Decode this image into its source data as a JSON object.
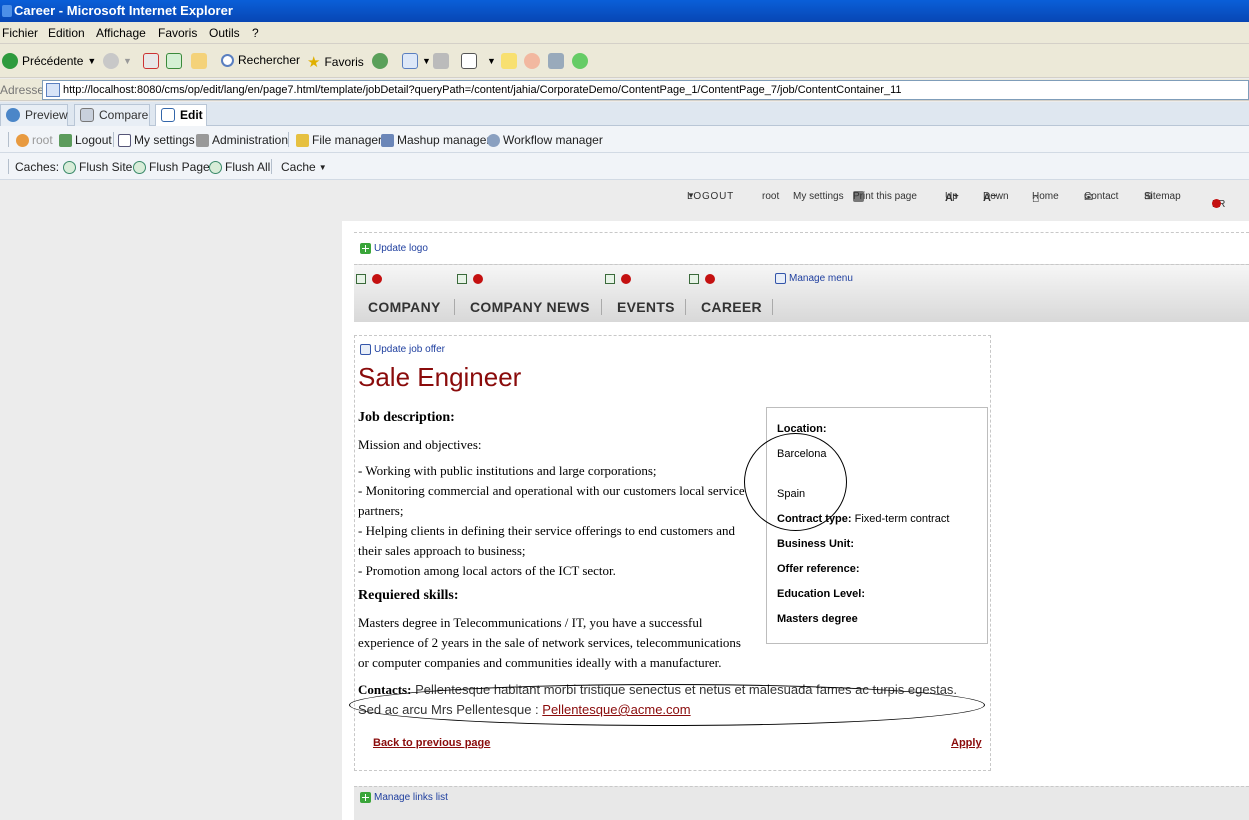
{
  "window": {
    "title": "Career - Microsoft Internet Explorer"
  },
  "menu": [
    "Fichier",
    "Edition",
    "Affichage",
    "Favoris",
    "Outils",
    "?"
  ],
  "toolbar": {
    "back": "Précédente",
    "search": "Rechercher",
    "favorites": "Favoris"
  },
  "address": {
    "label": "Adresse",
    "url": "http://localhost:8080/cms/op/edit/lang/en/page7.html/template/jobDetail?queryPath=/content/jahia/CorporateDemo/ContentPage_1/ContentPage_7/job/ContentContainer_11"
  },
  "tabs": [
    "Preview",
    "Compare",
    "Edit"
  ],
  "actions": {
    "user": "root",
    "logout": "Logout",
    "settings": "My settings",
    "admin": "Administration",
    "file_manager": "File manager",
    "mashup_manager": "Mashup manager",
    "workflow_manager": "Workflow manager"
  },
  "cache": {
    "label": "Caches:",
    "flush_site": "Flush Site",
    "flush_page": "Flush Page",
    "flush_all": "Flush All",
    "cache_menu": "Cache"
  },
  "utility": {
    "logout": "LOGOUT",
    "user": "root",
    "settings": "My settings",
    "print": "Print this page",
    "up": "Up",
    "down": "Down",
    "home": "Home",
    "contact": "Contact",
    "sitemap": "Sitemap",
    "lang": "FR"
  },
  "page": {
    "update_logo": "Update logo",
    "manage_menu": "Manage menu",
    "nav": [
      "COMPANY",
      "COMPANY NEWS",
      "EVENTS",
      "CAREER"
    ],
    "update_job": "Update job offer",
    "job_title": "Sale Engineer",
    "desc_heading": "Job description:",
    "desc_lines": [
      "Mission and objectives:",
      "- Working with public institutions and large corporations;",
      "- Monitoring commercial and operational with our customers local service",
      "partners;",
      "- Helping clients in defining their service offerings to end customers and",
      "their sales approach to business;",
      "- Promotion among local actors of the ICT sector."
    ],
    "skills_heading": "Requiered skills:",
    "skills_lines": [
      "Masters degree in Telecommunications / IT, you have a successful",
      "experience of 2 years in the sale of network services, telecommunications",
      "or computer companies and communities ideally with a manufacturer."
    ],
    "contacts_label": "Contacts:",
    "contacts_text": "Pellentesque habitant morbi tristique senectus et netus et malesuada fames ac turpis egestas.",
    "contacts_line2": "Sed ac arcu Mrs Pellentesque :",
    "contacts_email": "Pellentesque@acme.com",
    "back_link": "Back to previous page",
    "apply_link": "Apply",
    "manage_links": "Manage links list"
  },
  "info": {
    "location_label": "Location:",
    "city": "Barcelona",
    "country": "Spain",
    "contract_label": "Contract type:",
    "contract_value": "Fixed-term contract",
    "business_unit": "Business Unit:",
    "offer_ref": "Offer reference:",
    "education": "Education Level:",
    "degree": "Masters degree"
  }
}
